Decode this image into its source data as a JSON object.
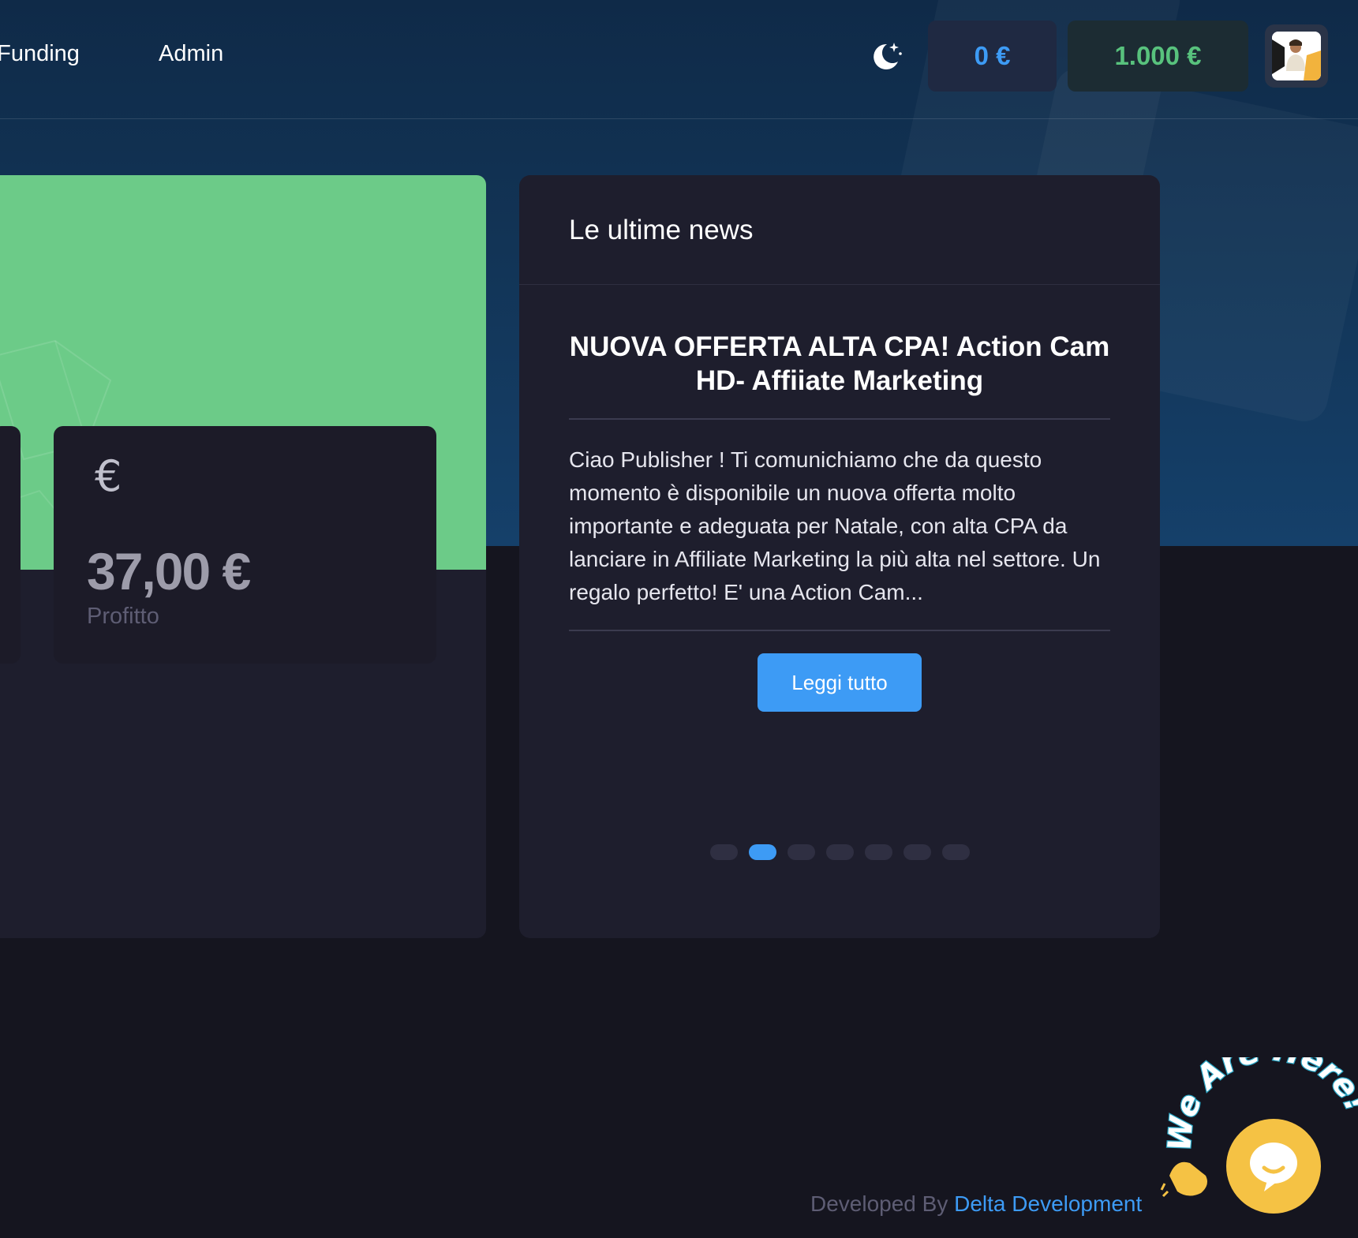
{
  "nav": {
    "items": [
      {
        "label": "dFunding"
      },
      {
        "label": "Admin"
      }
    ]
  },
  "header": {
    "theme_icon": "moon-stars-icon",
    "wallet_balance": "0 €",
    "wallet_credit": "1.000 €",
    "colors": {
      "balance": "#3d9bf5",
      "credit": "#58c27d"
    }
  },
  "stats": {
    "profit_icon": "euro-icon",
    "profit_symbol": "€",
    "profit_value": "37,00 €",
    "profit_label": "Profitto",
    "accent": "#6ccb88"
  },
  "news": {
    "title": "Le ultime news",
    "headline": "NUOVA OFFERTA ALTA CPA! Action Cam HD- Affiiate Marketing",
    "body": "Ciao Publisher !  Ti comunichiamo che da questo momento è disponibile un nuova offerta molto importante e adeguata per Natale, con alta CPA da lanciare in Affiliate Marketing la più alta nel settore. Un regalo perfetto! E' una Action Cam...",
    "read_more": "Leggi tutto",
    "slide_count": 7,
    "active_slide": 2
  },
  "footer": {
    "prefix": "Developed By",
    "brand": "Delta Development"
  },
  "chat": {
    "tagline": "We Are Here!",
    "bubble_color": "#f5c244"
  }
}
